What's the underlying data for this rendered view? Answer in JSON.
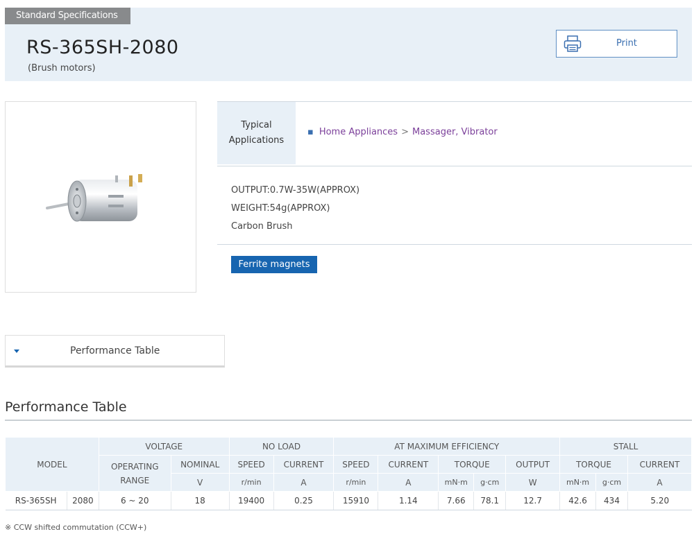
{
  "header": {
    "tag": "Standard Specifications",
    "model": "RS-365SH-2080",
    "subtitle": "(Brush motors)",
    "print_label": "Print"
  },
  "applications": {
    "label_line1": "Typical",
    "label_line2": "Applications",
    "category": "Home Appliances",
    "separator": ">",
    "item": "Massager, Vibrator"
  },
  "specs": [
    "OUTPUT:0.7W-35W(APPROX)",
    "WEIGHT:54g(APPROX)",
    "Carbon Brush"
  ],
  "ferrite_button": "Ferrite magnets",
  "performance_toggle": "Performance Table",
  "section_title": "Performance Table",
  "table": {
    "groups": {
      "model": "MODEL",
      "voltage": "VOLTAGE",
      "no_load": "NO LOAD",
      "max_eff": "AT MAXIMUM EFFICIENCY",
      "stall": "STALL"
    },
    "sub": {
      "operating_line1": "OPERATING",
      "operating_line2": "RANGE",
      "nominal": "NOMINAL",
      "speed": "SPEED",
      "current": "CURRENT",
      "torque": "TORQUE",
      "output": "OUTPUT"
    },
    "units": {
      "v": "V",
      "rmin1": "r/min",
      "a1": "A",
      "rmin2": "r/min",
      "a2": "A",
      "mNm1": "mN·m",
      "gcm1": "g·cm",
      "w": "W",
      "mNm2": "mN·m",
      "gcm2": "g·cm",
      "a3": "A"
    },
    "row": {
      "model": "RS-365SH",
      "variant": "2080",
      "operating_range": "6 ~ 20",
      "nominal": "18",
      "nl_speed": "19400",
      "nl_current": "0.25",
      "me_speed": "15910",
      "me_current": "1.14",
      "me_torque_mnm": "7.66",
      "me_torque_gcm": "78.1",
      "me_output": "12.7",
      "st_torque_mnm": "42.6",
      "st_torque_gcm": "434",
      "st_current": "5.20"
    }
  },
  "note": "※ CCW shifted commutation (CCW+)",
  "colors": {
    "accent": "#1765b0",
    "header_bg": "#e8f0f7",
    "tag_bg": "#888a8c",
    "link": "#7b3f9a"
  }
}
